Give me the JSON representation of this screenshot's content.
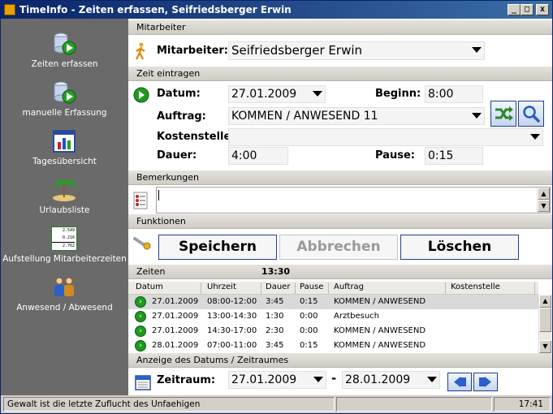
{
  "window": {
    "title": "TimeInfo - Zeiten erfassen, Seifriedsberger Erwin"
  },
  "sidebar": {
    "items": [
      {
        "label": "Zeiten erfassen",
        "icon": "clock-play-icon"
      },
      {
        "label": "manuelle Erfassung",
        "icon": "clock-play-icon"
      },
      {
        "label": "Tagesübersicht",
        "icon": "chart-icon"
      },
      {
        "label": "Urlaubsliste",
        "icon": "island-icon"
      },
      {
        "label": "Aufstellung Mitarbeiterzeiten",
        "icon": "table-icon"
      },
      {
        "label": "Anwesend / Abwesend",
        "icon": "people-icon"
      }
    ],
    "table_icon_values": [
      "2.549",
      "0.216",
      "2.762"
    ]
  },
  "sections": {
    "mitarbeiter": "Mitarbeiter",
    "zeit": "Zeit eintragen",
    "bemerkungen": "Bemerkungen",
    "funktionen": "Funktionen",
    "zeiten": "Zeiten",
    "anzeige": "Anzeige des Datums / Zeitraumes"
  },
  "mitarbeiter": {
    "label": "Mitarbeiter:",
    "value": "Seifriedsberger Erwin"
  },
  "zeit": {
    "datum_label": "Datum:",
    "datum_value": "27.01.2009",
    "beginn_label": "Beginn:",
    "beginn_value": "8:00",
    "auftrag_label": "Auftrag:",
    "auftrag_value": "KOMMEN / ANWESEND 11",
    "kostenstelle_label": "Kostenstelle:",
    "kostenstelle_value": "",
    "dauer_label": "Dauer:",
    "dauer_value": "4:00",
    "pause_label": "Pause:",
    "pause_value": "0:15"
  },
  "bemerkungen": {
    "value": ""
  },
  "funktionen": {
    "save": "Speichern",
    "cancel": "Abbrechen",
    "delete": "Löschen"
  },
  "zeiten": {
    "total": "13:30",
    "columns": [
      "Datum",
      "Uhrzeit",
      "Dauer",
      "Pause",
      "Auftrag",
      "Kostenstelle"
    ],
    "rows": [
      [
        "27.01.2009",
        "08:00-12:00",
        "3:45",
        "0:15",
        "KOMMEN / ANWESEND",
        ""
      ],
      [
        "27.01.2009",
        "13:00-14:30",
        "1:30",
        "0:00",
        "Arztbesuch",
        ""
      ],
      [
        "27.01.2009",
        "14:30-17:00",
        "2:30",
        "0:00",
        "KOMMEN / ANWESEND",
        ""
      ],
      [
        "28.01.2009",
        "07:00-11:00",
        "3:45",
        "0:15",
        "KOMMEN / ANWESEND",
        ""
      ]
    ]
  },
  "zeitraum": {
    "label": "Zeitraum:",
    "from": "27.01.2009",
    "separator": "-",
    "to": "28.01.2009"
  },
  "statusbar": {
    "message": "Gewalt ist die letzte Zuflucht des Unfaehigen",
    "middle": "",
    "time": "17:41"
  }
}
